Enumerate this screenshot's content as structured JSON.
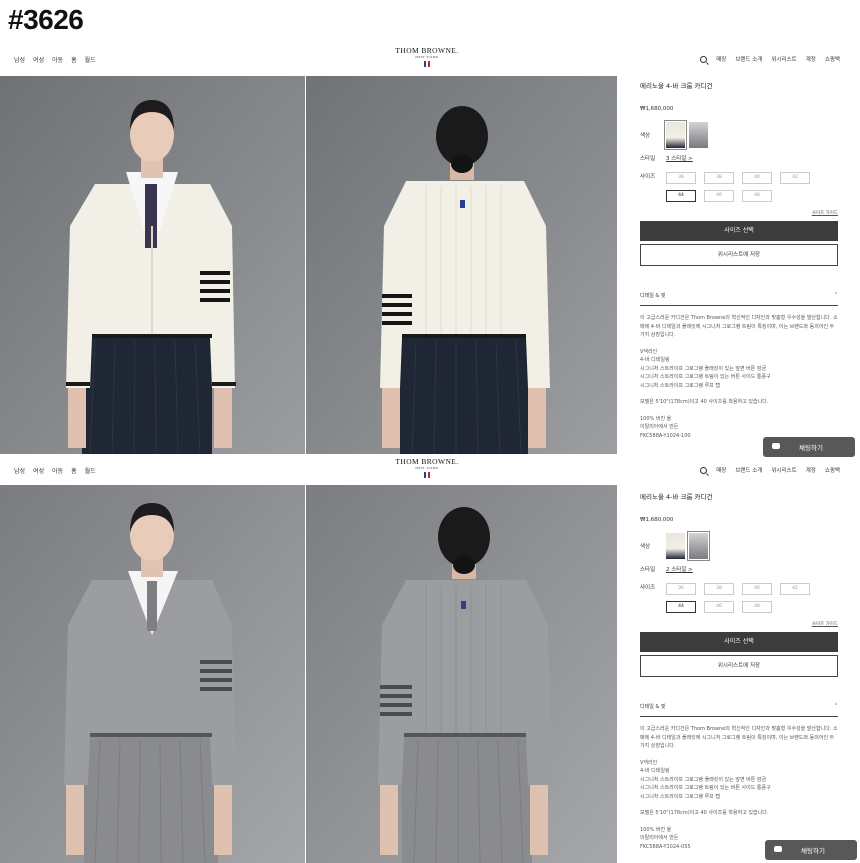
{
  "tag": "#3626",
  "panels": [
    {
      "nav_left": [
        "남성",
        "여성",
        "아동",
        "홈",
        "월드"
      ],
      "logo": {
        "brand": "THOM BROWNE.",
        "sub": "NEW YORK"
      },
      "nav_right": [
        "매장",
        "브랜드 소개",
        "위시리스트",
        "계정",
        "쇼핑백"
      ],
      "title": "메리노울 4-바 크롭 카디건",
      "price": "₩1,680,000",
      "color_label": "색상",
      "style_label": "스타일",
      "style_value": "3 스타일 >",
      "size_label": "사이즈",
      "sizes": [
        "36",
        "38",
        "40",
        "42",
        "44",
        "46",
        "48"
      ],
      "selected_size": "44",
      "size_guide": "사이즈 가이드",
      "select_size": "사이즈 선택",
      "wishlist": "위시리스트에 저장",
      "details_label": "디테일 & 핏",
      "description": "이 고급스러운 카디건은 Thom Browne의 혁신적인 디자인과 맞춤형 우수성을 발산합니다. 소매에 4-바 디테일과 플래킷에 시그니처 그로그랭 트림이 특징이며, 이는 브랜드와 동의어인 두 가지 상징입니다.",
      "features": [
        "V넥라인",
        "4-바 디테일링",
        "시그니처 스트라이프 그로그랭 플래킷이 있는 앞면 버튼 잠금",
        "시그니처 스트라이프 그로그랭 트림이 있는 버튼 사이드 통풍구",
        "시그니처 스트라이프 그로그랭 루프 탭"
      ],
      "model_note": "모델은 5'10\"(178cm)이고 40 사이즈를 착용하고 있습니다.",
      "material": [
        "100% 버진 울",
        "이탈리아에서 만든",
        "FKC588A-Y1024-100"
      ],
      "chat": "채팅하기",
      "colors": {
        "knit": "#f2efe6",
        "bg": "#8a8c8e"
      }
    },
    {
      "nav_left": [
        "남성",
        "여성",
        "아동",
        "홈",
        "월드"
      ],
      "logo": {
        "brand": "THOM BROWNE.",
        "sub": "NEW YORK"
      },
      "nav_right": [
        "매장",
        "브랜드 소개",
        "위시리스트",
        "계정",
        "쇼핑백"
      ],
      "title": "메리노울 4-바 크롭 카디건",
      "price": "₩1,680,000",
      "color_label": "색상",
      "style_label": "스타일",
      "style_value": "2 스타일 >",
      "size_label": "사이즈",
      "sizes": [
        "36",
        "38",
        "40",
        "42",
        "44",
        "46",
        "48"
      ],
      "selected_size": "44",
      "size_guide": "사이즈 가이드",
      "select_size": "사이즈 선택",
      "wishlist": "위시리스트에 저장",
      "details_label": "디테일 & 핏",
      "description": "이 고급스러운 카디건은 Thom Browne의 혁신적인 디자인과 맞춤형 우수성을 발산합니다. 소매에 4-바 디테일과 플래킷에 시그니처 그로그랭 트림이 특징이며, 이는 브랜드와 동의어인 두 가지 상징입니다.",
      "features": [
        "V넥라인",
        "4-바 디테일링",
        "시그니처 스트라이프 그로그랭 플래킷이 있는 앞면 버튼 잠금",
        "시그니처 스트라이프 그로그랭 트림이 있는 버튼 사이드 통풍구",
        "시그니처 스트라이프 그로그랭 루프 탭"
      ],
      "model_note": "모델은 5'10\"(178cm)이고 40 사이즈를 착용하고 있습니다.",
      "material": [
        "100% 버진 울",
        "이탈리아에서 만든",
        "FKC588A-Y1024-055"
      ],
      "chat": "채팅하기",
      "colors": {
        "knit": "#9b9da0",
        "bg": "#8d8f92"
      }
    }
  ]
}
